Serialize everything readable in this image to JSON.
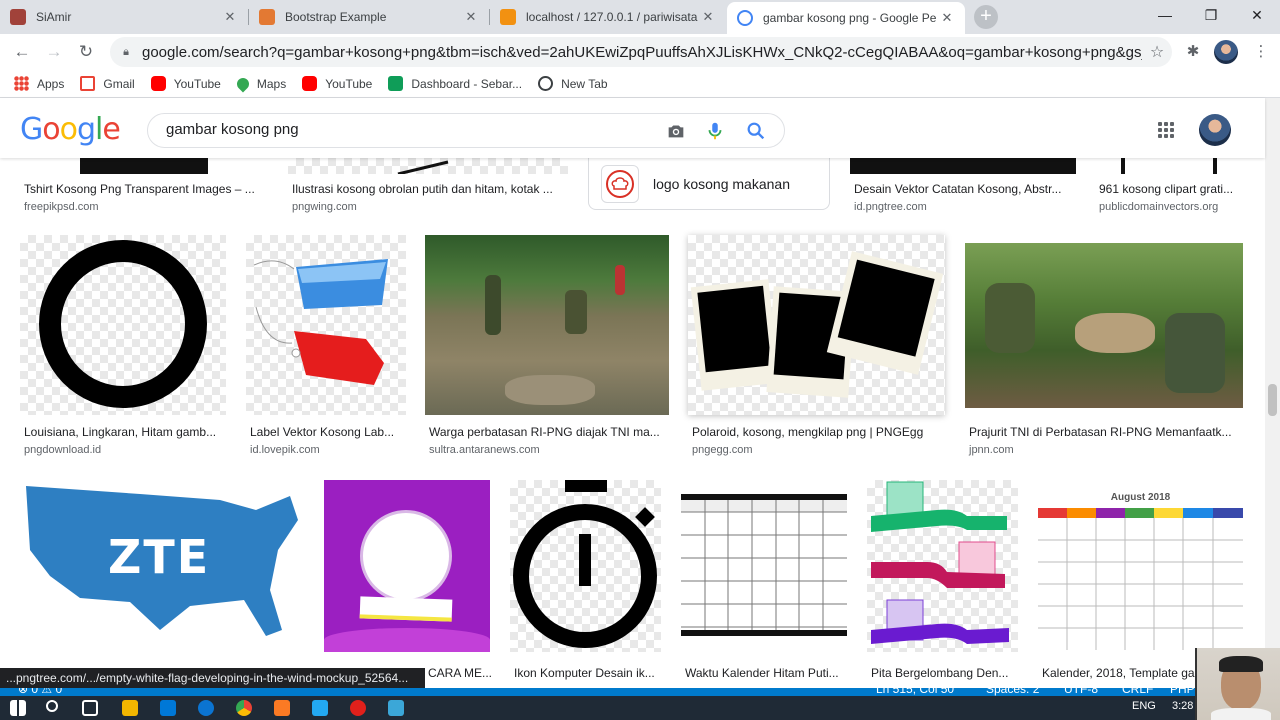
{
  "browser": {
    "tabs": [
      {
        "title": "SiAmir",
        "color": "#a1423a"
      },
      {
        "title": "Bootstrap Example",
        "color": "#e37933"
      },
      {
        "title": "localhost / 127.0.0.1 / pariwisata",
        "color": "#f29111"
      },
      {
        "title": "gambar kosong png - Google Pe",
        "color": "#4285f4",
        "active": true
      }
    ],
    "new_tab": "+",
    "window_controls": {
      "minimize": "—",
      "maximize": "❐",
      "close": "✕"
    },
    "url": "google.com/search?q=gambar+kosong+png&tbm=isch&ved=2ahUKEwiZpqPuuffsAhXJLisKHWx_CNkQ2-cCegQIABAA&oq=gambar+kosong+png&gs_lcp=C...",
    "bookmarks": [
      {
        "label": "Apps",
        "color": "#4285f4"
      },
      {
        "label": "Gmail",
        "color": "#ea4335"
      },
      {
        "label": "YouTube",
        "color": "#ff0000"
      },
      {
        "label": "Maps",
        "color": "#34a853"
      },
      {
        "label": "YouTube",
        "color": "#ff0000"
      },
      {
        "label": "Dashboard - Sebar...",
        "color": "#0f9d58"
      },
      {
        "label": "New Tab",
        "color": "#3c4043"
      }
    ]
  },
  "google": {
    "logo": {
      "G": "G",
      "o1": "o",
      "o2": "o",
      "g": "g",
      "l": "l",
      "e": "e"
    },
    "query": "gambar kosong png"
  },
  "results": {
    "top_row": [
      {
        "caption": "Tshirt Kosong Png Transparent Images – ...",
        "source": "freepikpsd.com"
      },
      {
        "caption": "Ilustrasi kosong obrolan putih dan hitam, kotak ...",
        "source": "pngwing.com"
      },
      {
        "caption": "Desain Vektor Catatan Kosong, Abstr...",
        "source": "id.pngtree.com"
      },
      {
        "caption": "961 kosong clipart grati...",
        "source": "publicdomainvectors.org"
      }
    ],
    "related_search": "logo kosong makanan",
    "row2": [
      {
        "caption": "Louisiana, Lingkaran, Hitam gamb...",
        "source": "pngdownload.id"
      },
      {
        "caption": "Label Vektor Kosong Lab...",
        "source": "id.lovepik.com"
      },
      {
        "caption": "Warga perbatasan RI-PNG diajak TNI ma...",
        "source": "sultra.antaranews.com"
      },
      {
        "caption": "Polaroid, kosong, mengkilap png | PNGEgg",
        "source": "pngegg.com"
      },
      {
        "caption": "Prajurit TNI di Perbatasan RI-PNG Memanfaatk...",
        "source": "jpnn.com"
      }
    ],
    "row3": [
      {
        "caption": "",
        "zte_text": "ZTE"
      },
      {
        "caption": "CARA ME..."
      },
      {
        "caption": "Ikon Komputer Desain ik..."
      },
      {
        "caption": "Waktu Kalender Hitam Puti..."
      },
      {
        "caption": "Pita Bergelombang Den..."
      },
      {
        "caption": "Kalender, 2018, Template ga...",
        "calendar_title": "August 2018"
      }
    ]
  },
  "link_status": "...pngtree.com/.../empty-white-flag-developing-in-the-wind-mockup_52564...",
  "editor_status": {
    "errors": "⊗ 0 ⚠ 0",
    "position": "Ln 515, Col 50",
    "spaces": "Spaces: 2",
    "encoding": "UTF-8",
    "eol": "CRLF",
    "lang": "PHP"
  },
  "taskbar": {
    "lang": "ENG",
    "time": "3:28"
  }
}
